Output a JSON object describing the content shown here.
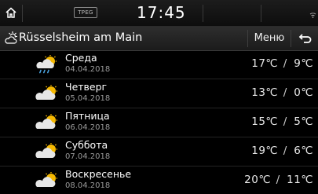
{
  "status_bar": {
    "home_icon": "home-icon",
    "tpeg_label": "TPEG",
    "time": "17:45",
    "signal_icon": "wifi-signal-icon"
  },
  "title_bar": {
    "weather_icon": "partly-sunny-icon",
    "city": "Rüsselsheim am Main",
    "menu_label": "Меню",
    "back_icon": "back-arrow-icon"
  },
  "forecast": [
    {
      "day": "Среда",
      "date": "04.04.2018",
      "high": "17℃",
      "low": "9℃",
      "icon": "sun-cloud-rain-icon"
    },
    {
      "day": "Четверг",
      "date": "05.04.2018",
      "high": "13℃",
      "low": "0℃",
      "icon": "sun-cloud-icon"
    },
    {
      "day": "Пятница",
      "date": "06.04.2018",
      "high": "15℃",
      "low": "5℃",
      "icon": "sun-cloud-icon"
    },
    {
      "day": "Суббота",
      "date": "07.04.2018",
      "high": "19℃",
      "low": "6℃",
      "icon": "sun-cloud-icon"
    },
    {
      "day": "Воскресенье",
      "date": "08.04.2018",
      "high": "20℃",
      "low": "11℃",
      "icon": "sun-cloud-icon"
    }
  ],
  "separator": "/",
  "colors": {
    "background": "#000000",
    "sun": "#f5b800",
    "cloud": "#e6e6e6",
    "rain": "#4aa3e0"
  }
}
